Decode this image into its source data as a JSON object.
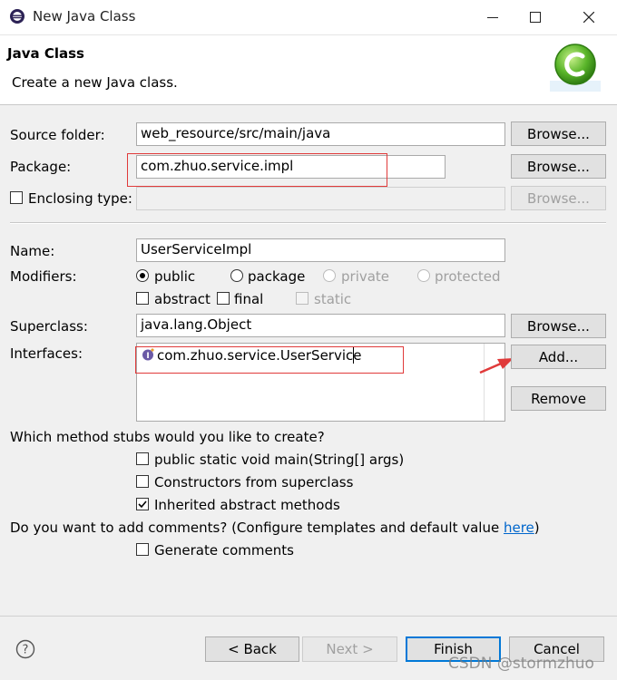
{
  "window": {
    "title": "New Java Class",
    "minimize_icon": "minimize-icon",
    "maximize_icon": "maximize-icon",
    "close_icon": "close-icon"
  },
  "header": {
    "title": "Java Class",
    "description": "Create a new Java class."
  },
  "form": {
    "source_folder_label": "Source folder:",
    "source_folder_value": "web_resource/src/main/java",
    "package_label": "Package:",
    "package_value": "com.zhuo.service.impl",
    "enclosing_type_label": "Enclosing type:",
    "enclosing_type_value": "",
    "browse_label": "Browse...",
    "name_label": "Name:",
    "name_value": "UserServiceImpl",
    "modifiers_label": "Modifiers:",
    "modifiers": {
      "public": "public",
      "package": "package",
      "private": "private",
      "protected": "protected",
      "abstract": "abstract",
      "final": "final",
      "static": "static"
    },
    "superclass_label": "Superclass:",
    "superclass_value": "java.lang.Object",
    "interfaces_label": "Interfaces:",
    "interfaces": [
      "com.zhuo.service.UserService"
    ],
    "add_label": "Add...",
    "remove_label": "Remove"
  },
  "stubs": {
    "question": "Which method stubs would you like to create?",
    "main": "public static void main(String[] args)",
    "constructors": "Constructors from superclass",
    "inherited": "Inherited abstract methods"
  },
  "comments": {
    "question": "Do you want to add comments? (Configure templates and default value ",
    "link": "here",
    "question_end": ")",
    "generate": "Generate comments"
  },
  "footer": {
    "back": "< Back",
    "next": "Next >",
    "finish": "Finish",
    "cancel": "Cancel",
    "help_icon": "help-icon"
  },
  "watermark": "CSDN @stormzhuo",
  "colors": {
    "annotation_red": "#e03a3a",
    "link_blue": "#0066cc",
    "default_button_border": "#0078d7"
  }
}
